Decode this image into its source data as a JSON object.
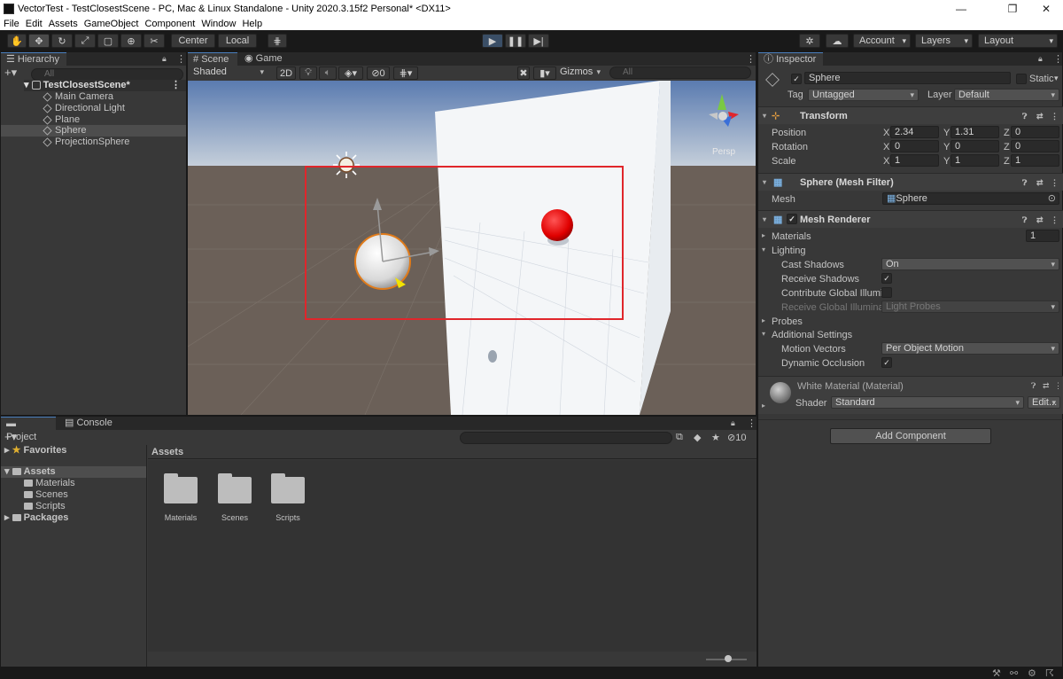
{
  "window": {
    "title": "VectorTest - TestClosestScene - PC, Mac & Linux Standalone - Unity 2020.3.15f2 Personal* <DX11>"
  },
  "menu": [
    "File",
    "Edit",
    "Assets",
    "GameObject",
    "Component",
    "Window",
    "Help"
  ],
  "toolbar": {
    "center_label": "Center",
    "local_label": "Local",
    "account_label": "Account",
    "layers_label": "Layers",
    "layout_label": "Layout"
  },
  "hierarchy": {
    "tab": "Hierarchy",
    "search_placeholder": "All",
    "scene": "TestClosestScene*",
    "items": [
      "Main Camera",
      "Directional Light",
      "Plane",
      "Sphere",
      "ProjectionSphere"
    ],
    "selected": "Sphere"
  },
  "scene_view": {
    "tabs": [
      "Scene",
      "Game"
    ],
    "shading": "Shaded",
    "mode_2d": "2D",
    "hidden_count": "0",
    "gizmos": "Gizmos",
    "search_placeholder": "All",
    "persp": "Persp",
    "colors": {
      "sky_top": "#5a7bb0",
      "sky_bottom": "#c9d2dc",
      "ground": "#6b6058",
      "highlight": "#e0262b"
    }
  },
  "project": {
    "tabs": [
      "Project",
      "Console"
    ],
    "favorites": "Favorites",
    "assets": "Assets",
    "asset_children": [
      "Materials",
      "Scenes",
      "Scripts"
    ],
    "packages": "Packages",
    "breadcrumb": "Assets",
    "folders": [
      "Materials",
      "Scenes",
      "Scripts"
    ],
    "hidden_count": "10"
  },
  "inspector": {
    "tab": "Inspector",
    "object_name": "Sphere",
    "static_label": "Static",
    "tag_label": "Tag",
    "tag_value": "Untagged",
    "layer_label": "Layer",
    "layer_value": "Default",
    "transform": {
      "title": "Transform",
      "rows": [
        {
          "label": "Position",
          "x": "2.34",
          "y": "1.31",
          "z": "0"
        },
        {
          "label": "Rotation",
          "x": "0",
          "y": "0",
          "z": "0"
        },
        {
          "label": "Scale",
          "x": "1",
          "y": "1",
          "z": "1"
        }
      ],
      "axes": [
        "X",
        "Y",
        "Z"
      ]
    },
    "mesh_filter": {
      "title": "Sphere (Mesh Filter)",
      "mesh_label": "Mesh",
      "mesh_value": "Sphere"
    },
    "mesh_renderer": {
      "title": "Mesh Renderer",
      "materials_label": "Materials",
      "materials_count": "1",
      "lighting_label": "Lighting",
      "cast_shadows_label": "Cast Shadows",
      "cast_shadows_value": "On",
      "receive_shadows_label": "Receive Shadows",
      "contribute_gi_label": "Contribute Global Illumi",
      "receive_gi_label": "Receive Global Illumina",
      "receive_gi_value": "Light Probes",
      "probes_label": "Probes",
      "additional_label": "Additional Settings",
      "motion_vectors_label": "Motion Vectors",
      "motion_vectors_value": "Per Object Motion",
      "dynamic_occlusion_label": "Dynamic Occlusion"
    },
    "material": {
      "title": "White Material (Material)",
      "shader_label": "Shader",
      "shader_value": "Standard",
      "edit_label": "Edit..."
    },
    "add_component": "Add Component"
  }
}
